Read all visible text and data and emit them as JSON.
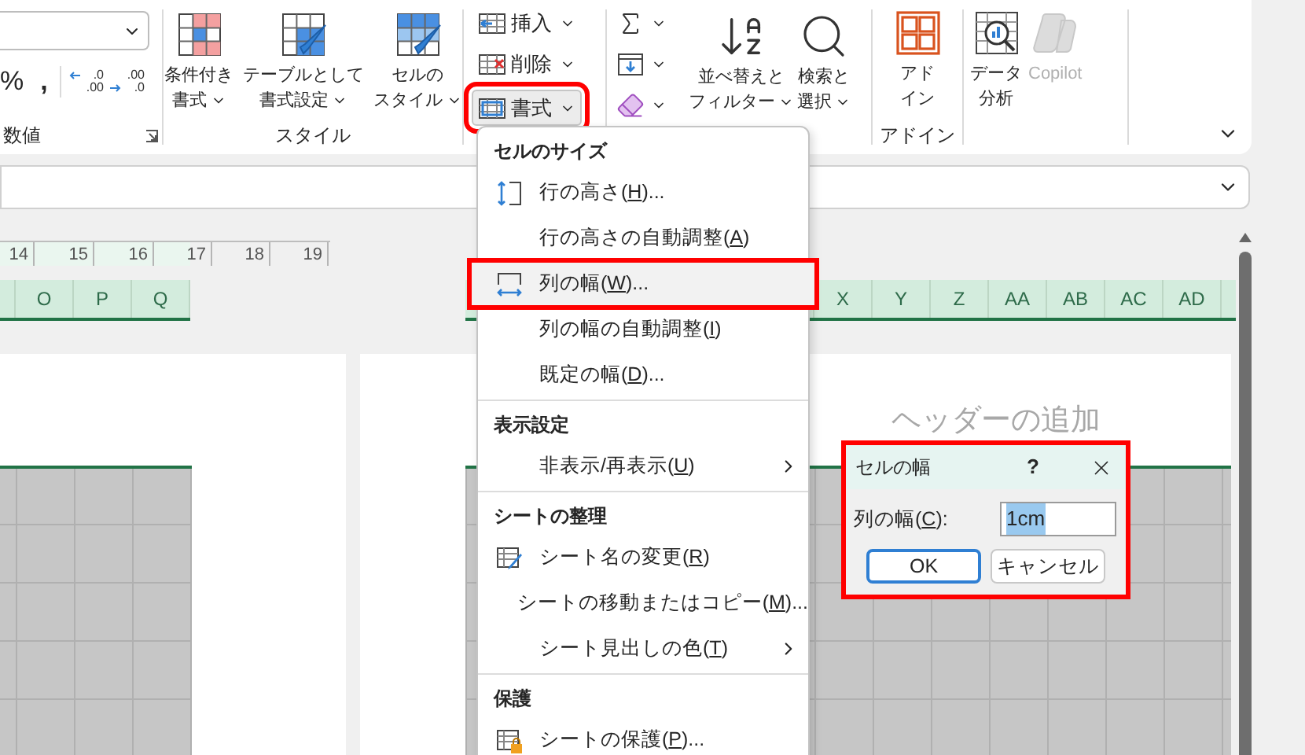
{
  "ribbon": {
    "number_group": {
      "label": "数値",
      "symbols": [
        "%",
        ","
      ],
      "decimal_buttons": [
        {
          "kind": "increase",
          "lines": [
            ".0",
            ".00"
          ]
        },
        {
          "kind": "decrease",
          "lines": [
            ".00",
            ".0"
          ]
        }
      ]
    },
    "style_group": {
      "label": "スタイル",
      "buttons": [
        {
          "kind": "conditional",
          "lines": [
            "条件付き",
            "書式"
          ],
          "dropdown": true,
          "disabled": false
        },
        {
          "kind": "table",
          "lines": [
            "テーブルとして",
            "書式設定"
          ],
          "dropdown": true,
          "disabled": false
        },
        {
          "kind": "cell_style",
          "lines": [
            "セルの",
            "スタイル"
          ],
          "dropdown": true,
          "disabled": false
        }
      ]
    },
    "cells_group": {
      "buttons": [
        {
          "kind": "insert",
          "label": "挿入",
          "open": false,
          "highlighted": false
        },
        {
          "kind": "delete",
          "label": "削除",
          "open": false,
          "highlighted": false
        },
        {
          "kind": "format",
          "label": "書式",
          "open": true,
          "highlighted": true
        }
      ]
    },
    "edit_group": {
      "small_buttons": [
        {
          "kind": "sum"
        },
        {
          "kind": "fill"
        },
        {
          "kind": "clear"
        }
      ],
      "buttons": [
        {
          "kind": "sort",
          "lines": [
            "並べ替えと",
            "フィルター"
          ],
          "dropdown": true,
          "disabled": false
        },
        {
          "kind": "find",
          "lines": [
            "検索と",
            "選択"
          ],
          "dropdown": true,
          "disabled": false
        }
      ]
    },
    "addin_group": {
      "label": "アドイン",
      "buttons": [
        {
          "kind": "addin",
          "lines": [
            "アド",
            "イン"
          ],
          "dropdown": false,
          "disabled": false
        }
      ]
    },
    "analysis_group": {
      "buttons": [
        {
          "kind": "analysis",
          "lines": [
            "データ",
            "分析"
          ],
          "dropdown": false,
          "disabled": false
        },
        {
          "kind": "copilot",
          "lines": [
            "Copilot"
          ],
          "dropdown": false,
          "disabled": true
        }
      ]
    }
  },
  "sheet": {
    "ruler": [
      "14",
      "15",
      "16",
      "17",
      "18",
      "19"
    ],
    "left_columns": [
      "O",
      "P",
      "Q"
    ],
    "right_columns": [
      "X",
      "Y",
      "Z",
      "AA",
      "AB",
      "AC",
      "AD"
    ],
    "header_placeholder": "ヘッダーの追加"
  },
  "menu": {
    "sections": [
      {
        "title": "セルのサイズ",
        "items": [
          {
            "pre": "行の高さ(",
            "key": "H",
            "post": ")...",
            "kind": "row_height",
            "submenu": false,
            "highlighted": false
          },
          {
            "pre": "行の高さの自動調整(",
            "key": "A",
            "post": ")",
            "submenu": false,
            "highlighted": false
          },
          {
            "pre": "列の幅(",
            "key": "W",
            "post": ")...",
            "kind": "column_width",
            "submenu": false,
            "highlighted": true
          },
          {
            "pre": "列の幅の自動調整(",
            "key": "I",
            "post": ")",
            "submenu": false,
            "highlighted": false
          },
          {
            "pre": "既定の幅(",
            "key": "D",
            "post": ")...",
            "submenu": false,
            "highlighted": false
          }
        ]
      },
      {
        "title": "表示設定",
        "items": [
          {
            "pre": "非表示/再表示(",
            "key": "U",
            "post": ")",
            "submenu": true,
            "highlighted": false
          }
        ]
      },
      {
        "title": "シートの整理",
        "items": [
          {
            "pre": "シート名の変更(",
            "key": "R",
            "post": ")",
            "kind": "rename",
            "submenu": false,
            "highlighted": false
          },
          {
            "pre": "シートの移動またはコピー(",
            "key": "M",
            "post": ")...",
            "submenu": false,
            "highlighted": false
          },
          {
            "pre": "シート見出しの色(",
            "key": "T",
            "post": ")",
            "submenu": true,
            "highlighted": false
          }
        ]
      },
      {
        "title": "保護",
        "items": [
          {
            "pre": "シートの保護(",
            "key": "P",
            "post": ")...",
            "kind": "protect",
            "submenu": false,
            "highlighted": false
          }
        ]
      }
    ]
  },
  "dialog": {
    "title": "セルの幅",
    "help": "?",
    "highlighted": true,
    "field_label": {
      "pre": "列の幅(",
      "key": "C",
      "post": "):"
    },
    "value": "1cm",
    "value_selected": true,
    "buttons": [
      {
        "label": "OK",
        "default": true
      },
      {
        "label": "キャンセル",
        "default": false
      }
    ]
  }
}
